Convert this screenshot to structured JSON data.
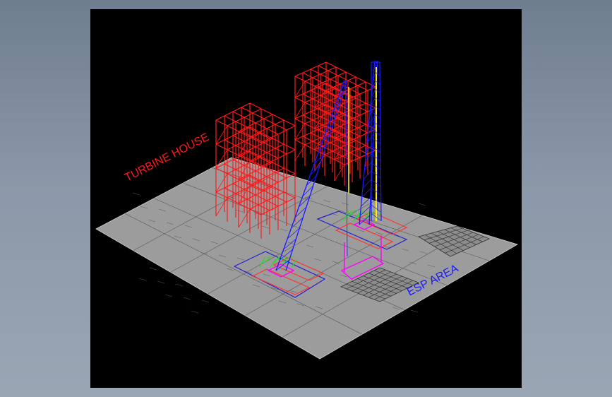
{
  "labels": {
    "turbine_house": "TURBINE HOUSE",
    "esp_area": "ESP AREA"
  },
  "colors": {
    "background": "#8a97a8",
    "viewport": "#000000",
    "plan_sheet": "#9c9c9c",
    "structure": "#ff1a1a",
    "crane_boom": "#1a1aff",
    "crane_base": "#ff00ff",
    "tracks": "#ff3333",
    "equipment": "#22dd22",
    "mast": "#ffee00",
    "plan_lines": "#5a5a5a",
    "outline": "#2222cc"
  }
}
